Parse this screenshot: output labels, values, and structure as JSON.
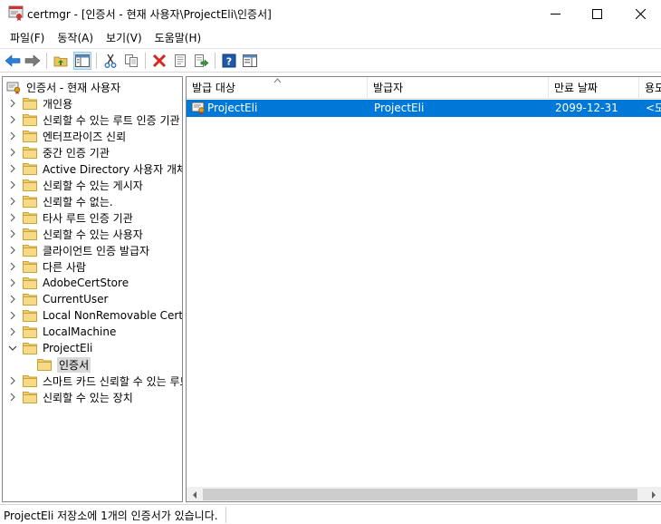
{
  "window": {
    "title": "certmgr - [인증서 - 현재 사용자\\ProjectEli\\인증서]"
  },
  "menu": {
    "items": [
      {
        "label": "파일(F)"
      },
      {
        "label": "동작(A)"
      },
      {
        "label": "보기(V)"
      },
      {
        "label": "도움말(H)"
      }
    ]
  },
  "toolbar": {
    "icons": [
      "back-arrow-icon",
      "forward-arrow-icon",
      "up-folder-icon",
      "show-hide-tree-icon",
      "cut-icon",
      "copy-icon",
      "delete-icon",
      "properties-icon",
      "export-icon",
      "help-icon",
      "console-view-icon"
    ]
  },
  "tree": {
    "root_label": "인증서 - 현재 사용자",
    "items": [
      {
        "label": "개인용"
      },
      {
        "label": "신뢰할 수 있는 루트 인증 기관"
      },
      {
        "label": "엔터프라이즈 신뢰"
      },
      {
        "label": "중간 인증 기관"
      },
      {
        "label": "Active Directory 사용자 개체"
      },
      {
        "label": "신뢰할 수 있는 게시자"
      },
      {
        "label": "신뢰할 수 없는."
      },
      {
        "label": "타사 루트 인증 기관"
      },
      {
        "label": "신뢰할 수 있는 사용자"
      },
      {
        "label": "클라이언트 인증 발급자"
      },
      {
        "label": "다른 사람"
      },
      {
        "label": "AdobeCertStore"
      },
      {
        "label": "CurrentUser"
      },
      {
        "label": "Local NonRemovable Certificates"
      },
      {
        "label": "LocalMachine"
      },
      {
        "label": "ProjectEli"
      },
      {
        "label": "인증서"
      },
      {
        "label": "스마트 카드 신뢰할 수 있는 루트"
      },
      {
        "label": "신뢰할 수 있는 장치"
      }
    ]
  },
  "list": {
    "columns": [
      "발급 대상",
      "발급자",
      "만료 날짜",
      "용도"
    ],
    "rows": [
      {
        "issued_to": "ProjectEli",
        "issued_by": "ProjectEli",
        "expiration": "2099-12-31",
        "purpose": "<모든 용도>"
      }
    ]
  },
  "status": {
    "text": "ProjectEli 저장소에 1개의 인증서가 있습니다."
  },
  "colors": {
    "selection": "#0078d7",
    "tree_selection": "#d9d9d9",
    "folder": "#f2cd6b"
  }
}
